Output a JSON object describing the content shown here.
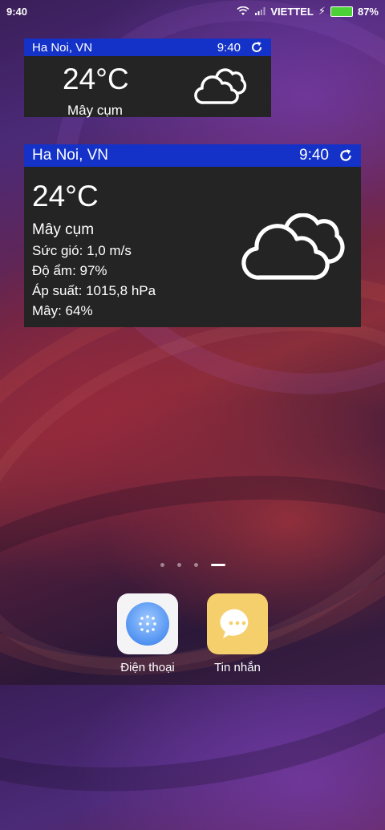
{
  "statusbar": {
    "time": "9:40",
    "carrier": "VIETTEL",
    "battery": "87%",
    "battery_level": 0.87
  },
  "widget_small": {
    "location": "Ha Noi, VN",
    "time": "9:40",
    "temperature": "24°C",
    "condition": "Mây cụm"
  },
  "widget_large": {
    "location": "Ha Noi, VN",
    "time": "9:40",
    "temperature": "24°C",
    "condition": "Mây cụm",
    "wind": "Sức gió: 1,0 m/s",
    "humidity": "Độ ẩm: 97%",
    "pressure": "Áp suất: 1015,8 hPa",
    "clouds": "Mây: 64%"
  },
  "pages": {
    "count": 4,
    "active": 4
  },
  "dock": [
    {
      "label": "Điện thoại",
      "icon": "phone-dialer-icon"
    },
    {
      "label": "Tin nhắn",
      "icon": "message-bubble-icon"
    }
  ]
}
